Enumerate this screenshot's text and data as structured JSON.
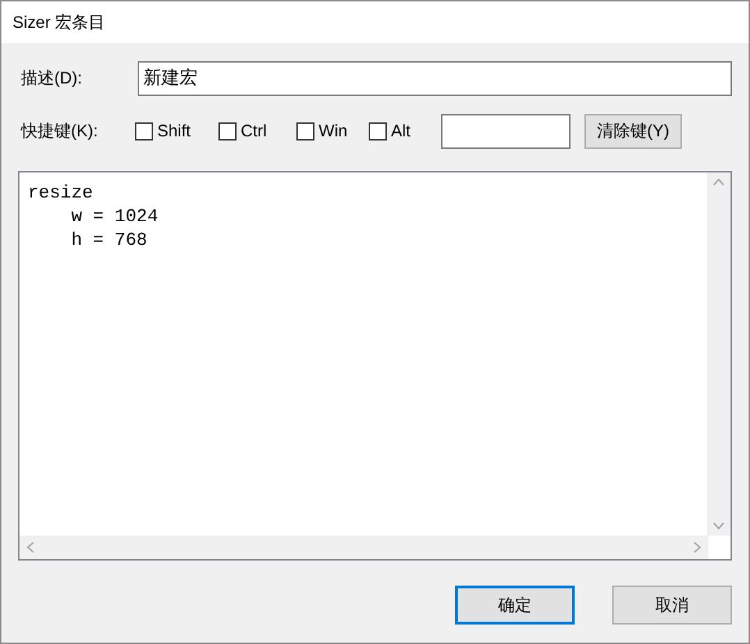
{
  "window": {
    "title": "Sizer 宏条目"
  },
  "description": {
    "label": "描述(D):",
    "value": "新建宏"
  },
  "shortcut": {
    "label": "快捷键(K):",
    "modifiers": [
      {
        "label": "Shift",
        "checked": false
      },
      {
        "label": "Ctrl",
        "checked": false
      },
      {
        "label": "Win",
        "checked": false
      },
      {
        "label": "Alt",
        "checked": false
      }
    ],
    "clear_button": "清除键(Y)"
  },
  "editor": {
    "lines": [
      "resize",
      "    w = 1024",
      "    h = 768"
    ]
  },
  "buttons": [
    {
      "label": "确定",
      "default": true
    },
    {
      "label": "取消",
      "default": false
    }
  ]
}
